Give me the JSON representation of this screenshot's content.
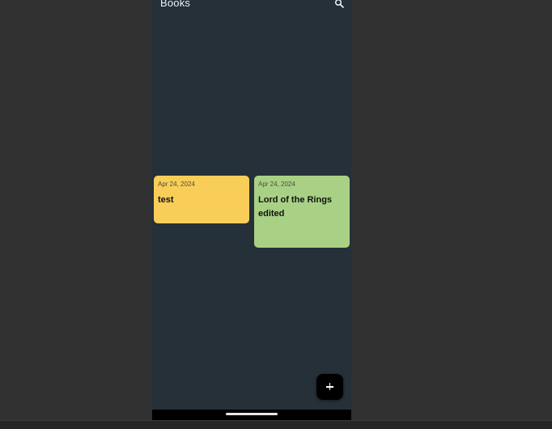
{
  "app": {
    "title": "Books",
    "search_icon": "search-icon",
    "fab_icon": "plus-icon"
  },
  "colors": {
    "screen_bg": "#253038",
    "outer_bg": "#313131",
    "fab_bg": "#000000"
  },
  "cards": [
    {
      "date": "Apr 24, 2024",
      "title": "test",
      "color": "#f9ce58"
    },
    {
      "date": "Apr 24, 2024",
      "title": "Lord of the Rings edited",
      "color": "#a9d185"
    }
  ]
}
